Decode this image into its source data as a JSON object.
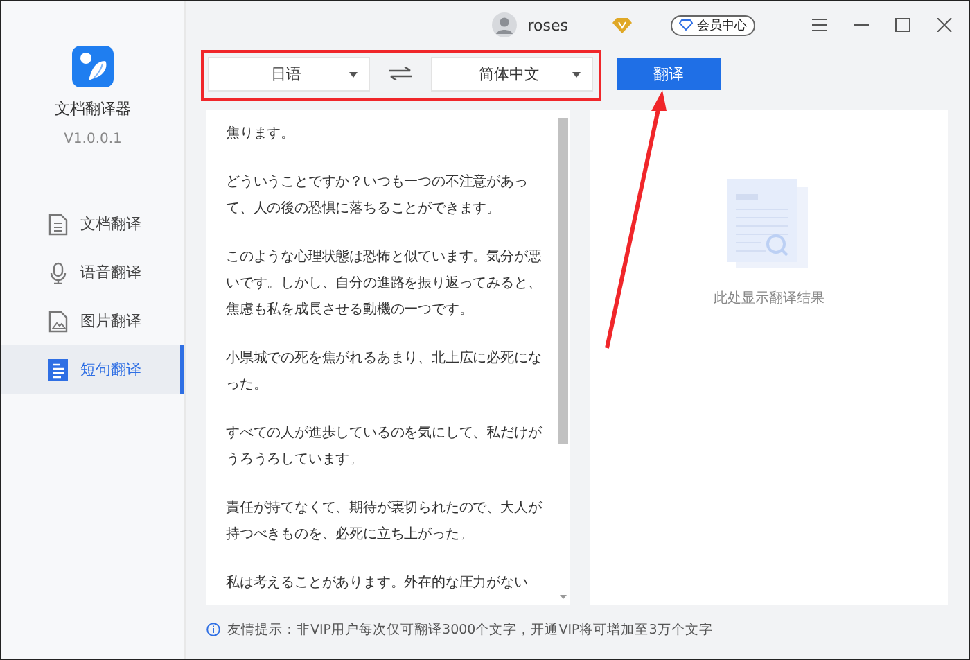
{
  "app": {
    "name": "文档翻译器",
    "version": "V1.0.0.1"
  },
  "sidebar": {
    "items": [
      {
        "label": "文档翻译",
        "kind": "document",
        "selected": false
      },
      {
        "label": "语音翻译",
        "kind": "microphone",
        "selected": false
      },
      {
        "label": "图片翻译",
        "kind": "image",
        "selected": false
      },
      {
        "label": "短句翻译",
        "kind": "text",
        "selected": true
      }
    ]
  },
  "user": {
    "name": "roses"
  },
  "vip_button": "会员中心",
  "toolbar": {
    "source_language": "日语",
    "target_language": "简体中文",
    "translate_button": "翻译"
  },
  "source_text": {
    "paragraphs": [
      "焦ります。",
      "どういうことですか？いつも一つの不注意があって、人の後の恐惧に落ちることができます。",
      "このような心理状態は恐怖と似ています。気分が悪いです。しかし、自分の進路を振り返ってみると、焦慮も私を成長させる動機の一つです。",
      "小県城での死を焦がれるあまり、北上広に必死になった。",
      "すべての人が進歩しているのを気にして、私だけがうろうろしています。",
      "責任が持てなくて、期待が裏切られたので、大人が持つべきものを、必死に立ち上がった。",
      "私は考えることがあります。外在的な圧力がない"
    ]
  },
  "result": {
    "placeholder": "此处显示翻译结果"
  },
  "tip": {
    "text": "友情提示：非VIP用户每次仅可翻译3000个文字，开通VIP将可增加至3万个文字"
  }
}
